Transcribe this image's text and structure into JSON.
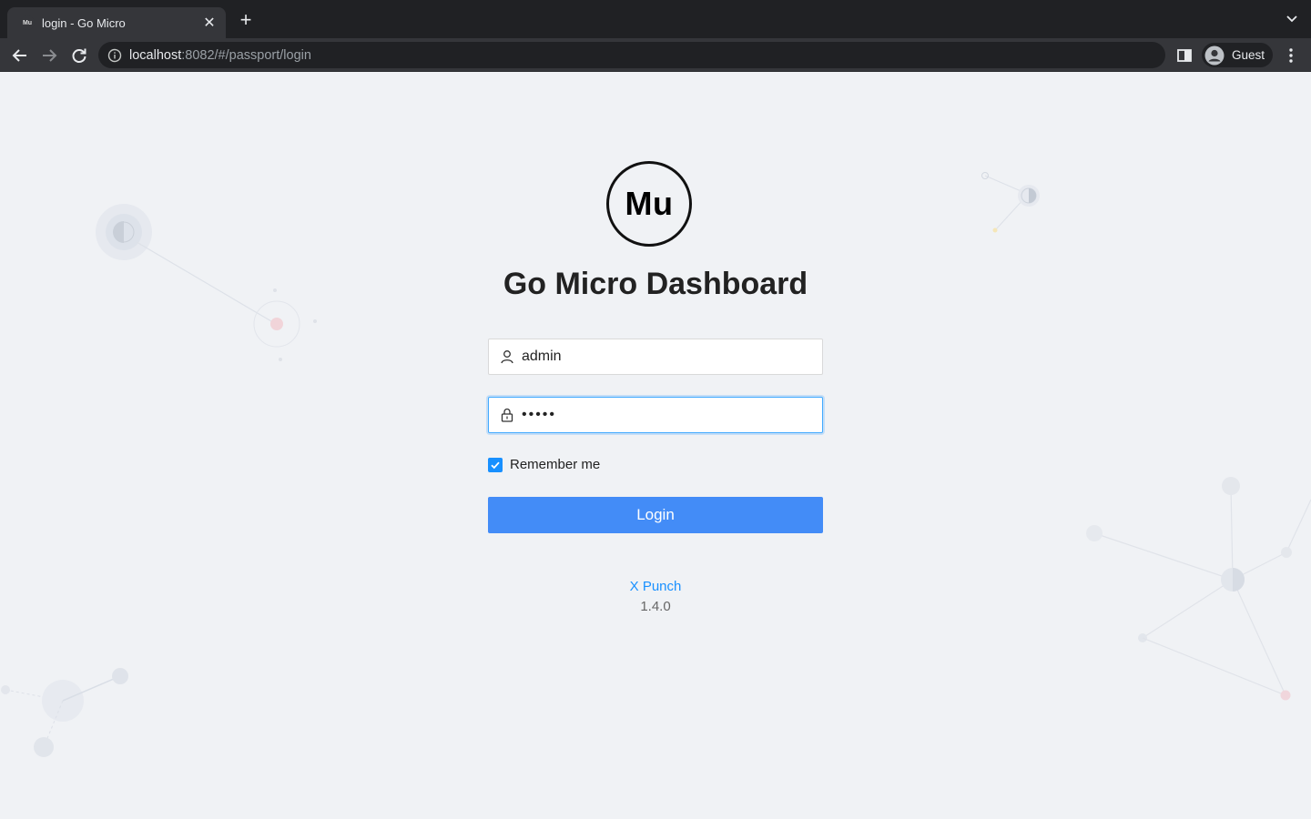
{
  "browser": {
    "tab": {
      "favicon_text": "Mu",
      "title": "login - Go Micro",
      "close": "✕"
    },
    "new_tab": "+",
    "url": {
      "host": "localhost",
      "rest": ":8082/#/passport/login"
    },
    "profile": "Guest"
  },
  "login": {
    "logo_text": "Mu",
    "title": "Go Micro Dashboard",
    "username": {
      "value": "admin"
    },
    "password": {
      "value": "admin"
    },
    "remember_label": "Remember me",
    "remember_checked": true,
    "submit_label": "Login"
  },
  "footer": {
    "link": "X Punch",
    "version": "1.4.0"
  },
  "colors": {
    "primary": "#1890ff",
    "button": "#438cf7",
    "background": "#f0f2f5"
  }
}
